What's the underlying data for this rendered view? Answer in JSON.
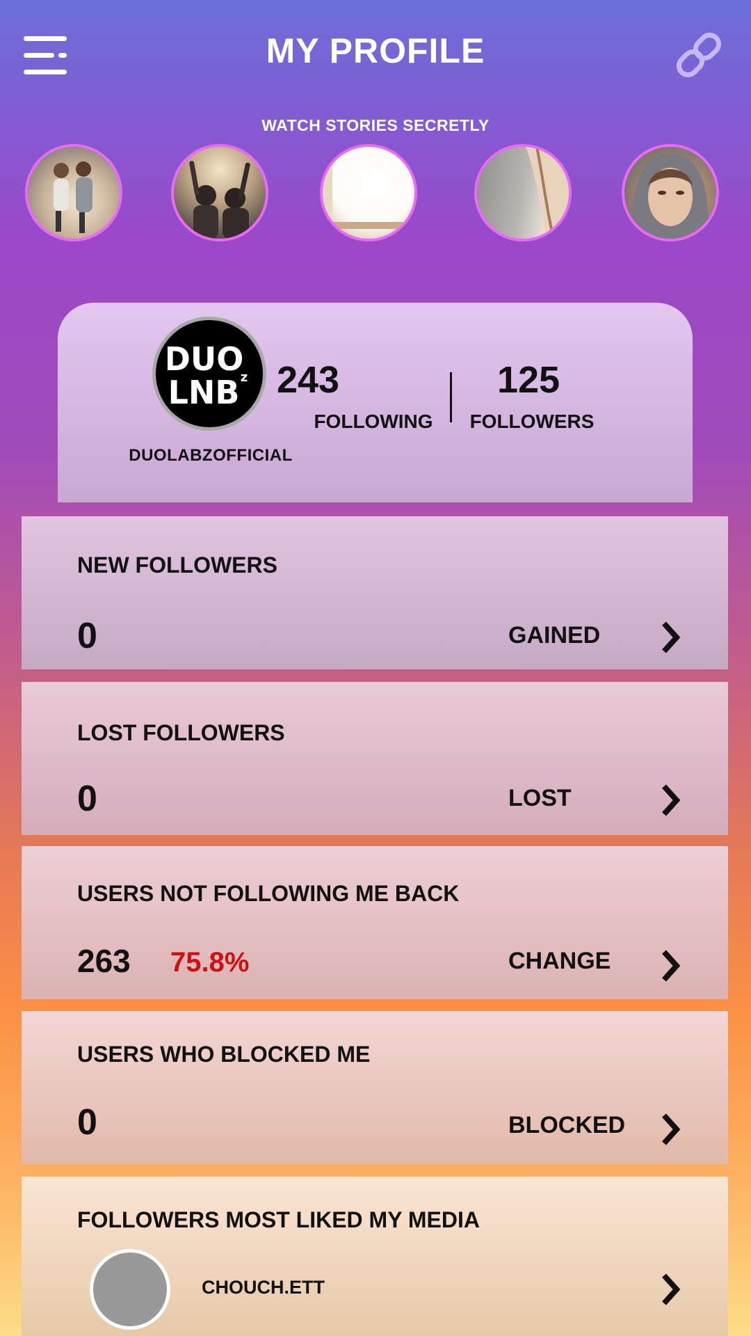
{
  "header": {
    "title": "MY PROFILE",
    "menu_icon": "hamburger-menu-icon",
    "link_icon": "link-icon"
  },
  "stories": {
    "label": "WATCH STORIES SECRETLY",
    "ring_color": "#e66cf0"
  },
  "profile": {
    "username": "DUOLABZOFFICIAL",
    "avatar_text_line1": "DUO",
    "avatar_text_line2": "LNB",
    "avatar_text_sup": "z",
    "following_count": "243",
    "following_label": "FOLLOWING",
    "followers_count": "125",
    "followers_label": "FOLLOWERS"
  },
  "rows": [
    {
      "title": "NEW FOLLOWERS",
      "value": "0",
      "action": "GAINED"
    },
    {
      "title": "LOST FOLLOWERS",
      "value": "0",
      "action": "LOST"
    },
    {
      "title": "USERS NOT FOLLOWING ME BACK",
      "value": "263",
      "percent": "75.8%",
      "action": "CHANGE"
    },
    {
      "title": "USERS WHO BLOCKED ME",
      "value": "0",
      "action": "BLOCKED"
    },
    {
      "title": "FOLLOWERS MOST LIKED MY MEDIA",
      "top_user": "CHOUCH.ETT"
    }
  ],
  "colors": {
    "percent_red": "#cc1111",
    "text": "#111111"
  }
}
